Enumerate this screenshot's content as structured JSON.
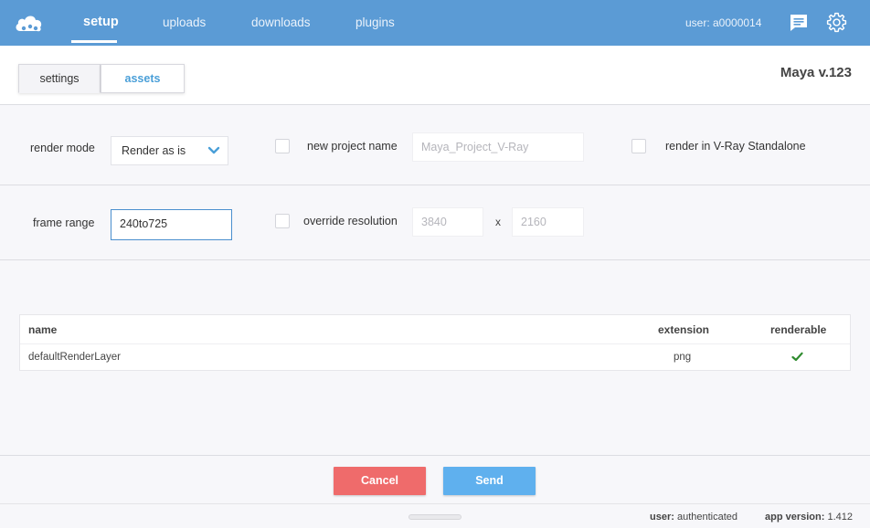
{
  "header": {
    "nav": [
      "setup",
      "uploads",
      "downloads",
      "plugins"
    ],
    "user_label": "user: a0000014"
  },
  "tabs": [
    "settings",
    "assets"
  ],
  "app_title": "Maya v.123",
  "form": {
    "render_mode_label": "render mode",
    "render_mode_value": "Render as is",
    "new_project_label": "new project name",
    "project_name_placeholder": "Maya_Project_V-Ray",
    "vray_standalone_label": "render in V-Ray Standalone",
    "frame_range_label": "frame range",
    "frame_range_value": "240to725",
    "override_resolution_label": "override resolution",
    "res_width_placeholder": "3840",
    "res_x_label": "x",
    "res_height_placeholder": "2160"
  },
  "layers": {
    "columns": [
      "name",
      "extension",
      "renderable"
    ],
    "rows": [
      {
        "name": "defaultRenderLayer",
        "extension": "png",
        "renderable": true
      }
    ]
  },
  "buttons": {
    "cancel": "Cancel",
    "send": "Send"
  },
  "status": {
    "user_key": "user:",
    "user_value": "authenticated",
    "version_key": "app version:",
    "version_value": "1.412"
  },
  "colors": {
    "header": "#5b9bd5",
    "cancel": "#ef6b6b",
    "send": "#5fb0ee",
    "check": "#2e8b2e"
  }
}
